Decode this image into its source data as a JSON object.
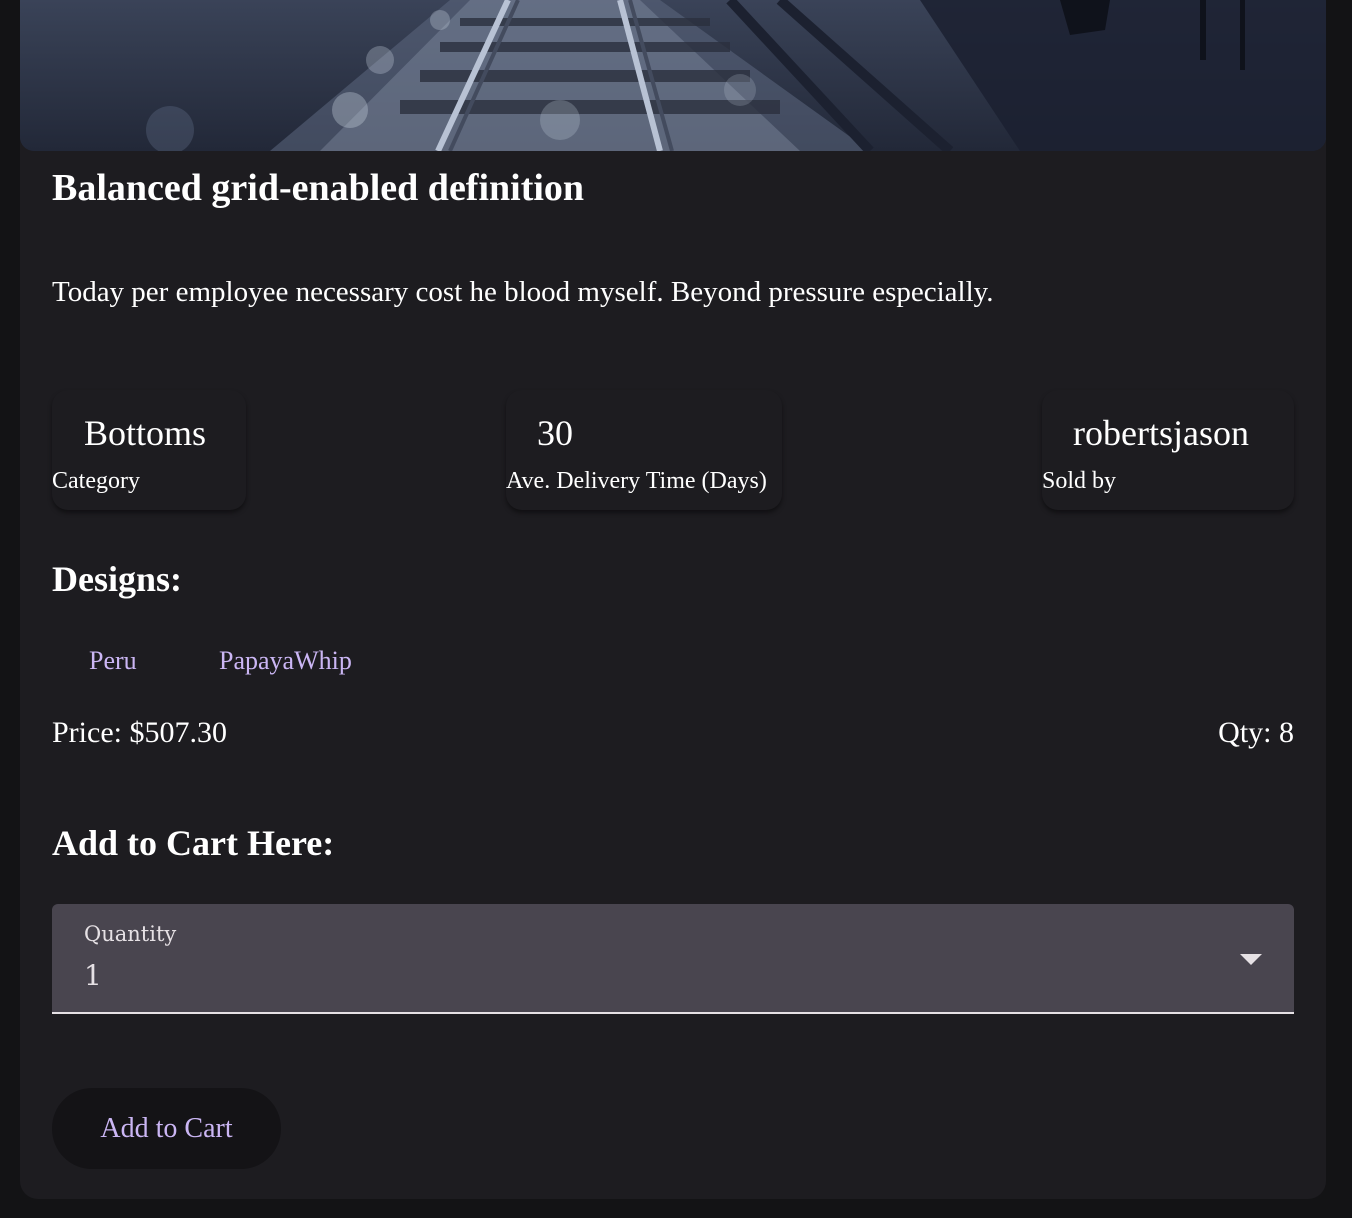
{
  "product": {
    "title": "Balanced grid-enabled definition",
    "description": "Today per employee necessary cost he blood myself. Beyond pressure especially."
  },
  "stats": {
    "category": {
      "value": "Bottoms",
      "label": "Category"
    },
    "delivery": {
      "value": "30",
      "label": "Ave. Delivery Time (Days)"
    },
    "seller": {
      "value": "robertsjason",
      "label": "Sold by"
    }
  },
  "designs": {
    "heading": "Designs:",
    "items": [
      "Peru",
      "PapayaWhip"
    ]
  },
  "pricing": {
    "price_text": "Price: $507.30",
    "qty_text": "Qty: 8"
  },
  "cart": {
    "heading": "Add to Cart Here:",
    "quantity_label": "Quantity",
    "quantity_value": "1",
    "button_label": "Add to Cart"
  },
  "colors": {
    "accent": "#cbb6f4",
    "card_bg": "#1d1c20",
    "page_bg": "#131315",
    "select_bg": "#49454f"
  },
  "icons": {
    "select_caret": "chevron-down-icon"
  }
}
